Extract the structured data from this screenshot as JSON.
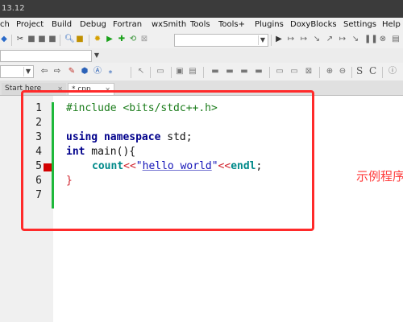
{
  "window": {
    "title": "13.12"
  },
  "menu": [
    "ch",
    "Project",
    "Build",
    "Debug",
    "Fortran",
    "wxSmith",
    "Tools",
    "Tools+",
    "Plugins",
    "DoxyBlocks",
    "Settings",
    "Help"
  ],
  "tabs": [
    {
      "label": "Start here"
    },
    {
      "label": "*.cpp"
    }
  ],
  "editor": {
    "line_numbers": [
      "1",
      "2",
      "3",
      "4",
      "5",
      "6",
      "7"
    ],
    "code": {
      "line1": "#include <bits/stdc++.h>",
      "line3_kw1": "using",
      "line3_kw2": "namespace",
      "line3_rest": " std;",
      "line4_type": "int",
      "line4_rest": " main(){",
      "line5_fn": "count",
      "line5_op1": "<<",
      "line5_q1": "\"",
      "line5_str": "hello world",
      "line5_q2": "\"",
      "line5_op2": "<<",
      "line5_endl": "endl",
      "line5_end": ";",
      "line6": "}"
    }
  },
  "annotation": {
    "label": "示例程序",
    "color": "#ff2a2a"
  },
  "colors": {
    "keyword": "#00008b",
    "preprocessor": "#1b7c1b",
    "string": "#1414b8",
    "operator": "#d0202a",
    "changebar": "#1eb83b",
    "breakpoint": "#d20000"
  }
}
